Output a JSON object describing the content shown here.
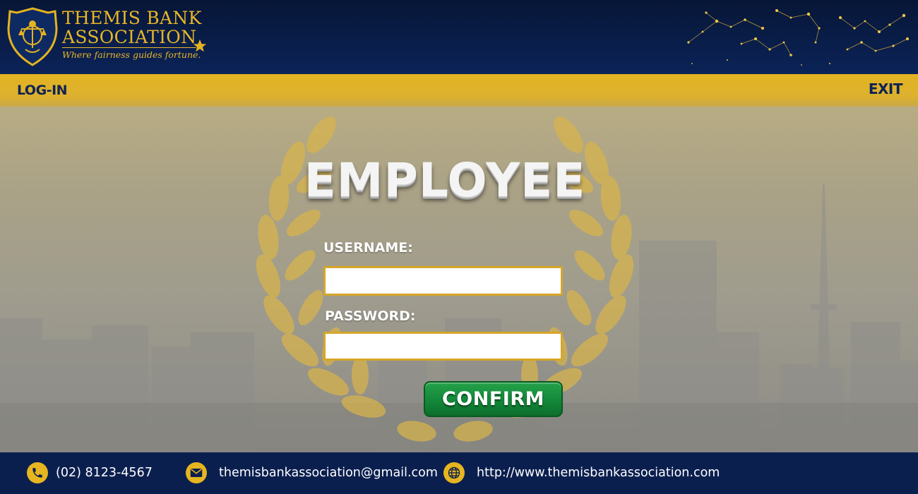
{
  "brand": {
    "line1": "THEMIS BANK",
    "line2": "ASSOCIATION",
    "tagline": "Where fairness guides fortune.",
    "icons": [
      "lady-justice-badge-icon",
      "star-icon",
      "constellation-icon"
    ]
  },
  "nav": {
    "login_label": "LOG-IN",
    "exit_label": "EXIT"
  },
  "main": {
    "heading": "EMPLOYEE",
    "username_label": "USERNAME:",
    "username_value": "",
    "password_label": "PASSWORD:",
    "password_value": "",
    "confirm_label": "CONFIRM"
  },
  "footer": {
    "phone": "(02) 8123-4567",
    "email": "themisbankassociation@gmail.com",
    "website": "http://www.themisbankassociation.com",
    "icons": [
      "phone-icon",
      "mail-icon",
      "globe-icon"
    ]
  },
  "colors": {
    "navy": "#0b1f4f",
    "gold": "#e3b321",
    "green": "#13883a",
    "white": "#ffffff"
  }
}
